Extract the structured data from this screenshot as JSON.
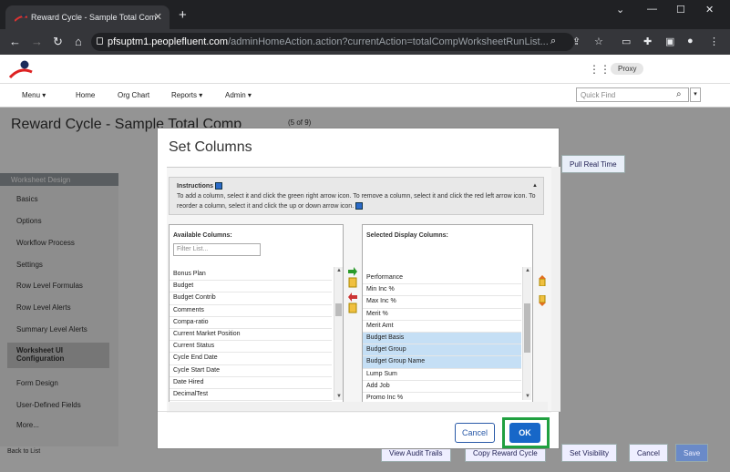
{
  "browser": {
    "tab_title": "Reward Cycle - Sample Total Com",
    "url_domain": "pfsuptm1.peoplefluent.com",
    "url_path": "/adminHomeAction.action?currentAction=totalCompWorksheetRunList...",
    "new_tab": "+",
    "close": "✕"
  },
  "header": {
    "proxy_label": "Proxy"
  },
  "menu": {
    "items": [
      "Menu ▾",
      "Home",
      "Org Chart",
      "Reports ▾",
      "Admin ▾"
    ],
    "quick_find_placeholder": "Quick Find"
  },
  "page": {
    "title": "Reward Cycle - Sample Total Comp",
    "pager": "(5 of 9)"
  },
  "sidebar": {
    "header": "Worksheet Design",
    "items": [
      "Basics",
      "Options",
      "Workflow Process",
      "Settings",
      "Row Level Formulas",
      "Row Level Alerts",
      "Summary Level Alerts",
      "Worksheet UI Configuration",
      "Form Design",
      "User-Defined Fields",
      "More..."
    ],
    "back": "Back to List"
  },
  "background_buttons": {
    "view_audit": "View Audit Trails",
    "copy": "Copy Reward Cycle",
    "visibility": "Set Visibility",
    "cancel": "Cancel",
    "save": "Save",
    "pull": "Pull Real Time"
  },
  "dialog": {
    "title": "Set Columns",
    "instructions_label": "Instructions",
    "instructions_text": "To add a column, select it and click the green right arrow icon. To remove a column, select it and click the red left arrow icon. To reorder a column, select it and click the up or down arrow icon.",
    "available": {
      "title": "Available Columns:",
      "filter_placeholder": "Filter List...",
      "items": [
        "Bonus Plan",
        "Budget",
        "Budget Contrib",
        "Comments",
        "Compa-ratio",
        "Current Market Position",
        "Current Status",
        "Cycle End Date",
        "Cycle Start Date",
        "Date Hired",
        "DecimalTest"
      ]
    },
    "selected": {
      "title": "Selected Display Columns:",
      "items": [
        "Performance",
        "Min Inc %",
        "Max Inc %",
        "Merit %",
        "Merit Amt",
        "Budget Basis",
        "Budget Group",
        "Budget Group Name",
        "Lump Sum",
        "Add Job",
        "Promo Inc %"
      ],
      "selected_items": [
        "Budget Basis",
        "Budget Group",
        "Budget Group Name"
      ]
    },
    "cancel_label": "Cancel",
    "ok_label": "OK"
  },
  "colors": {
    "ok_blue": "#1767c8",
    "highlight_green": "#20a040",
    "selected_row": "#c5dff5"
  }
}
